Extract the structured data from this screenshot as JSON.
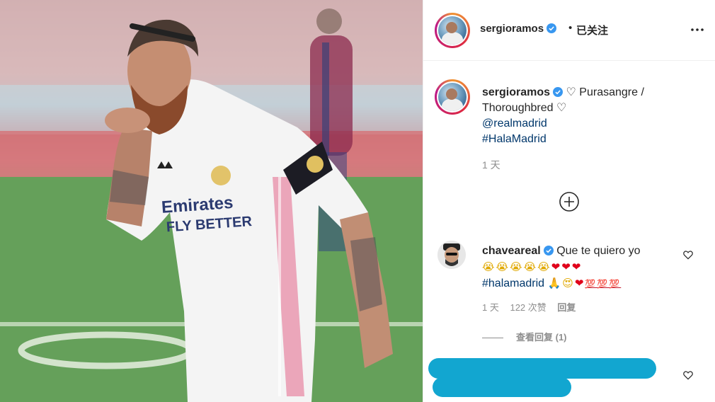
{
  "post": {
    "author": "sergioramos",
    "follow_separator": "•",
    "follow_status": "已关注"
  },
  "caption": {
    "author": "sergioramos",
    "line1": "♡ Purasangre /",
    "line2": "Thoroughbred ♡",
    "mention": "@realmadrid",
    "hashtag": "#HalaMadrid",
    "time": "1 天"
  },
  "comment": {
    "author": "chaveareal",
    "text": "Que te quiero yo",
    "emoji_cry": "😭😭😭😭😭",
    "emoji_hearts": "❤❤❤",
    "hashtag": "#halamadrid",
    "emoji_pray": "🙏",
    "emoji_eyes": "😍",
    "emoji_heart": "❤",
    "emoji_100": "💯💯💯",
    "time": "1 天",
    "likes": "122 次赞",
    "reply_label": "回复",
    "view_replies": "查看回复 (1)"
  },
  "icons": {
    "more": "more-horizontal-icon",
    "add_comment": "plus-circle-icon",
    "like": "heart-outline-icon",
    "verified": "verified-badge-icon"
  },
  "colors": {
    "link": "#00376b",
    "verified": "#3897f0",
    "secondary_text": "#8e8e8e",
    "redaction": "#12a6d0"
  }
}
